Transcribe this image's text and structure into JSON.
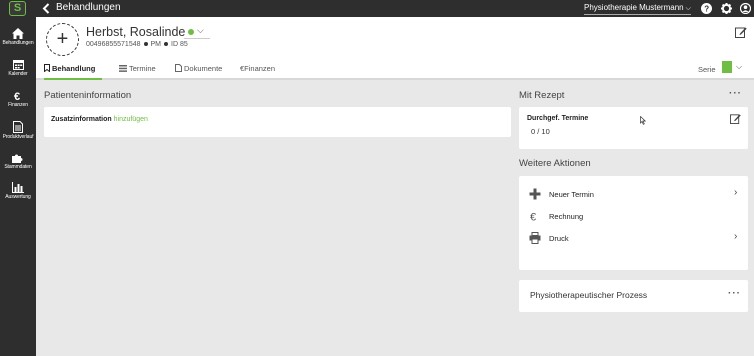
{
  "app": {
    "logo_letter": "S",
    "title": "Behandlungen",
    "practice": "Physiotherapie Mustermann"
  },
  "sidebar": {
    "items": [
      {
        "label": "Behandlungen",
        "icon": "home-icon"
      },
      {
        "label": "Kalender",
        "icon": "calendar-icon"
      },
      {
        "label": "Finanzen",
        "icon": "euro-icon"
      },
      {
        "label": "Produktverlauf",
        "icon": "document-icon"
      },
      {
        "label": "Stammdaten",
        "icon": "puzzle-icon"
      },
      {
        "label": "Auswertung",
        "icon": "bar-chart-icon"
      }
    ]
  },
  "patient": {
    "name": "Herbst, Rosalinde",
    "phone": "00496855571548",
    "initials": "PM",
    "id": "ID 85",
    "status_color": "#6fbe44",
    "avatar_symbol": "+"
  },
  "tabs": [
    {
      "label": "Behandlung",
      "icon": "bookmark-icon",
      "active": true
    },
    {
      "label": "Termine",
      "icon": "list-icon",
      "active": false
    },
    {
      "label": "Dokumente",
      "icon": "file-icon",
      "active": false
    },
    {
      "label": "Finanzen",
      "icon": "euro-icon",
      "active": false
    }
  ],
  "serie": {
    "label": "Serie"
  },
  "patient_info": {
    "title": "Patienteninformation",
    "zusatz_label": "Zusatzinformation",
    "zusatz_link": "hinzufügen"
  },
  "rezept": {
    "title": "Mit Rezept",
    "label": "Durchgef. Termine",
    "count": "0 / 10",
    "more": "···"
  },
  "actions": {
    "title": "Weitere Aktionen",
    "items": [
      {
        "label": "Neuer Termin",
        "icon": "plus-icon",
        "chevron": true
      },
      {
        "label": "Rechnung",
        "icon": "euro-icon",
        "chevron": false
      },
      {
        "label": "Druck",
        "icon": "printer-icon",
        "chevron": true
      }
    ]
  },
  "process": {
    "title": "Physiotherapeutischer Prozess",
    "more": "···"
  },
  "colors": {
    "accent": "#6fbe44",
    "sidebar": "#2e2e2e",
    "background": "#e8e8e8"
  }
}
